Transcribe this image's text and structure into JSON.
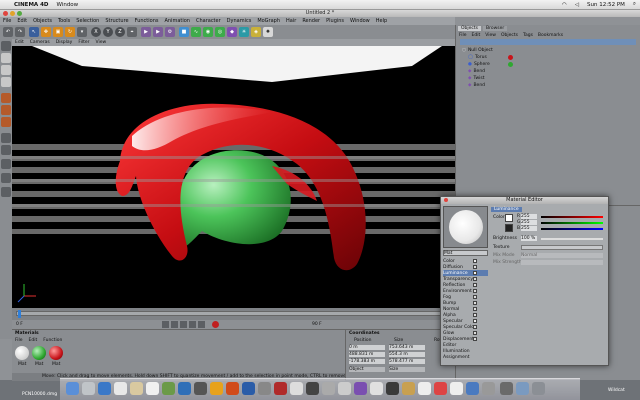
{
  "menubar": {
    "app": "CINEMA 4D",
    "items": [
      "Window"
    ],
    "clock": "Sun 12:52 PM"
  },
  "window": {
    "title": "Untitled 2 *"
  },
  "c4d_menu": [
    "File",
    "Edit",
    "Objects",
    "Tools",
    "Selection",
    "Structure",
    "Functions",
    "Animation",
    "Character",
    "Dynamics",
    "MoGraph",
    "Hair",
    "Render",
    "Plugins",
    "Window",
    "Help"
  ],
  "viewport_menu": [
    "Edit",
    "Cameras",
    "Display",
    "Filter",
    "View"
  ],
  "objects_panel": {
    "tabs": [
      "Objects",
      "Browser"
    ],
    "menu": [
      "File",
      "Edit",
      "View",
      "Objects",
      "Tags",
      "Bookmarks"
    ],
    "items": [
      {
        "label": "Null Object",
        "indent": 0
      },
      {
        "label": "Torus",
        "indent": 1
      },
      {
        "label": "Sphere",
        "indent": 1
      },
      {
        "label": "Bend",
        "indent": 1
      },
      {
        "label": "Twist",
        "indent": 1
      },
      {
        "label": "Bend",
        "indent": 1
      }
    ]
  },
  "materials_panel": {
    "title": "Materials",
    "menu": [
      "File",
      "Edit",
      "Function"
    ],
    "materials": [
      {
        "name": "Mat",
        "color": "#f2f2f2"
      },
      {
        "name": "Mat",
        "color": "#2fa830"
      },
      {
        "name": "Mat",
        "color": "#c8141a"
      }
    ]
  },
  "coordinates_panel": {
    "title": "Coordinates",
    "headers": [
      "Position",
      "Size",
      "Rotation"
    ],
    "rows": [
      [
        "0 m",
        "753.643 m",
        ""
      ],
      [
        "488.831 m",
        "554.3 m",
        ""
      ],
      [
        "-178.383 m",
        "578.477 m",
        ""
      ]
    ],
    "dropdowns": [
      "Object",
      "Size"
    ]
  },
  "material_editor": {
    "title": "Material Editor",
    "section": "Luminance",
    "material_name": "Mat",
    "color_label": "Color",
    "rgb": [
      "R",
      "G",
      "B"
    ],
    "rgb_values": [
      "255",
      "255",
      "255"
    ],
    "brightness_label": "Brightness",
    "brightness_value": "100 %",
    "texture_label": "Texture",
    "mix_mode_label": "Mix Mode",
    "mix_mode_value": "Normal",
    "mix_strength_label": "Mix Strength",
    "channels": [
      {
        "label": "Color",
        "checked": true
      },
      {
        "label": "Diffusion",
        "checked": false
      },
      {
        "label": "Luminance",
        "checked": true,
        "active": true
      },
      {
        "label": "Transparency",
        "checked": false
      },
      {
        "label": "Reflection",
        "checked": false
      },
      {
        "label": "Environment",
        "checked": false
      },
      {
        "label": "Fog",
        "checked": false
      },
      {
        "label": "Bump",
        "checked": false
      },
      {
        "label": "Normal",
        "checked": false
      },
      {
        "label": "Alpha",
        "checked": false
      },
      {
        "label": "Specular",
        "checked": true
      },
      {
        "label": "Specular Color",
        "checked": false
      },
      {
        "label": "Glow",
        "checked": false
      },
      {
        "label": "Displacement",
        "checked": false
      },
      {
        "label": "Editor",
        "checked": null
      },
      {
        "label": "Illumination",
        "checked": null
      },
      {
        "label": "Assignment",
        "checked": null
      }
    ]
  },
  "statusbar": {
    "text": "Move: Click and drag to move elements. Hold down SHIFT to quantize movement / add to the selection in point mode, CTRL to remove."
  },
  "timeline": {
    "start": "0 F",
    "end": "90 F"
  },
  "desktop": {
    "file_label": "PCN10000.dmg",
    "corner_label": "Wildcat"
  },
  "colors": {
    "viewport_bg": "#000000",
    "red_object": "#d0141a",
    "green_object": "#3fb04a"
  }
}
